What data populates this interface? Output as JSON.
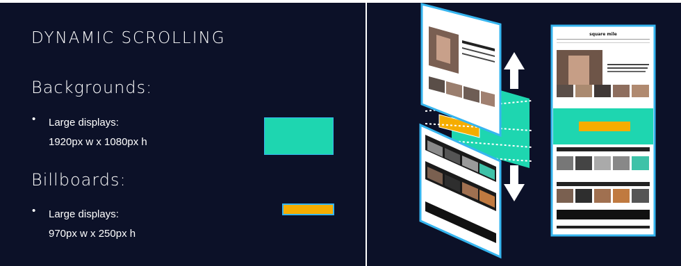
{
  "slide": {
    "title": "DYNAMIC SCROLLING",
    "sections": [
      {
        "heading": "Backgrounds:",
        "bullet_label": "Large displays:",
        "bullet_value": "1920px w x 1080px h"
      },
      {
        "heading": "Billboards:",
        "bullet_label": "Large displays:",
        "bullet_value": "970px w x 250px h"
      }
    ],
    "bullet_glyph": "•"
  },
  "mockup": {
    "site_name": "square mile",
    "headline": "Jean Pitson on Game of Thrones, Mafia and Marvel's intruders"
  },
  "colors": {
    "background": "#0c1128",
    "teal": "#1ed6b0",
    "orange": "#f5ad00",
    "frame_blue": "#36b5ef",
    "white": "#ffffff"
  },
  "icons": [
    "up-down-arrow-icon"
  ]
}
